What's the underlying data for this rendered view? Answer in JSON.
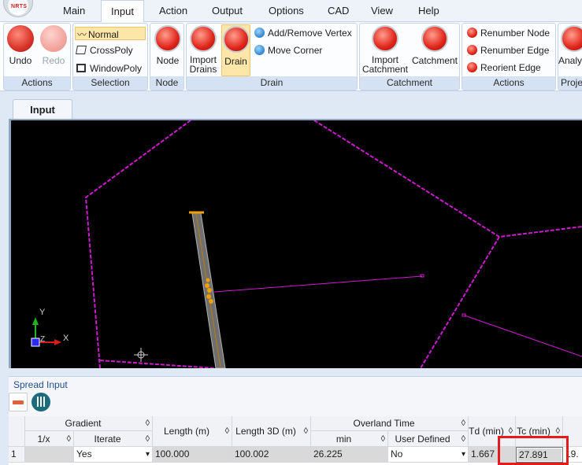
{
  "app": {
    "logo_text": "NRTS"
  },
  "menu": {
    "items": [
      "Main",
      "Input",
      "Action",
      "Output",
      "Options",
      "CAD",
      "View",
      "Help"
    ],
    "active": "Input"
  },
  "ribbon": {
    "actions": {
      "label": "Actions",
      "undo": "Undo",
      "redo": "Redo"
    },
    "selection": {
      "label": "Selection",
      "normal": "Normal",
      "crosspoly": "CrossPoly",
      "windowpoly": "WindowPoly"
    },
    "node": {
      "label": "Node",
      "node": "Node"
    },
    "drain": {
      "label": "Drain",
      "import_drains_l1": "Import",
      "import_drains_l2": "Drains",
      "drain": "Drain",
      "add_remove_vertex": "Add/Remove Vertex",
      "move_corner": "Move Corner"
    },
    "catchment": {
      "label": "Catchment",
      "import_catchment_l1": "Import",
      "import_catchment_l2": "Catchment",
      "catchment": "Catchment"
    },
    "actions2": {
      "label": "Actions",
      "renumber_node": "Renumber Node",
      "renumber_edge": "Renumber Edge",
      "reorient_edge": "Reorient Edge"
    },
    "analysis_partial": "Analy",
    "project_partial": "Proje"
  },
  "doc_tab": {
    "label": "Input"
  },
  "canvas": {
    "axis_y": "Y",
    "axis_x": "X",
    "axis_z": "Z"
  },
  "spread": {
    "title": "Spread Input",
    "headers": {
      "gradient": "Gradient",
      "one_over_x": "1/x",
      "iterate": "Iterate",
      "length": "Length (m)",
      "length3d": "Length 3D (m)",
      "overland_time": "Overland Time",
      "min": "min",
      "user_defined": "User Defined",
      "td": "Td (min)",
      "tc": "Tc (min)",
      "sort_glyph": "◊"
    },
    "row": {
      "index": "1",
      "one_over_x": "",
      "iterate": "Yes",
      "length": "100.000",
      "length3d": "100.002",
      "overland_min": "26.225",
      "user_defined": "No",
      "td": "1.667",
      "tc": "27.891",
      "next_partial": "19."
    },
    "dropdown_arrow": "▾"
  },
  "colors": {
    "catchment_boundary": "#d01ad0",
    "drain_fill": "#8a8a8a",
    "node_marker": "#f0a000",
    "highlight": "#e31b1b"
  }
}
